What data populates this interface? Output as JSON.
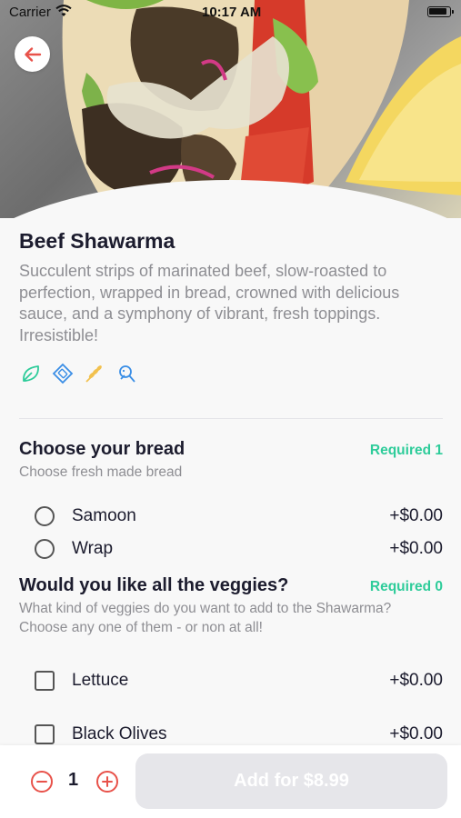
{
  "status_bar": {
    "carrier": "Carrier",
    "time": "10:17 AM"
  },
  "hero": {
    "image": "beef-shawarma-photo"
  },
  "product": {
    "title": "Beef Shawarma",
    "description": "Succulent strips of marinated beef, slow-roasted to perfection, wrapped in bread, crowned with delicious sauce, and a symphony of vibrant, fresh toppings. Irresistible!",
    "diet_icons": [
      "leaf-icon",
      "tag-icon",
      "wheat-icon",
      "fish-icon"
    ]
  },
  "sections": [
    {
      "title": "Choose your bread",
      "requirement": "Required 1",
      "subtitle": "Choose fresh made bread",
      "control": "radio",
      "options": [
        {
          "label": "Samoon",
          "price": "+$0.00"
        },
        {
          "label": "Wrap",
          "price": "+$0.00"
        }
      ]
    },
    {
      "title": "Would you like all the veggies?",
      "requirement": "Required 0",
      "subtitle": "What kind of veggies do you want to add to the Shawarma? Choose any one of them - or non at all!",
      "control": "checkbox",
      "options": [
        {
          "label": "Lettuce",
          "price": "+$0.00"
        },
        {
          "label": "Black Olives",
          "price": "+$0.00"
        }
      ]
    }
  ],
  "footer": {
    "quantity": "1",
    "add_button": "Add for $8.99"
  },
  "colors": {
    "accent_red": "#e8524a",
    "required_green": "#2ecc9a",
    "disabled_button": "#e6e6ea"
  }
}
